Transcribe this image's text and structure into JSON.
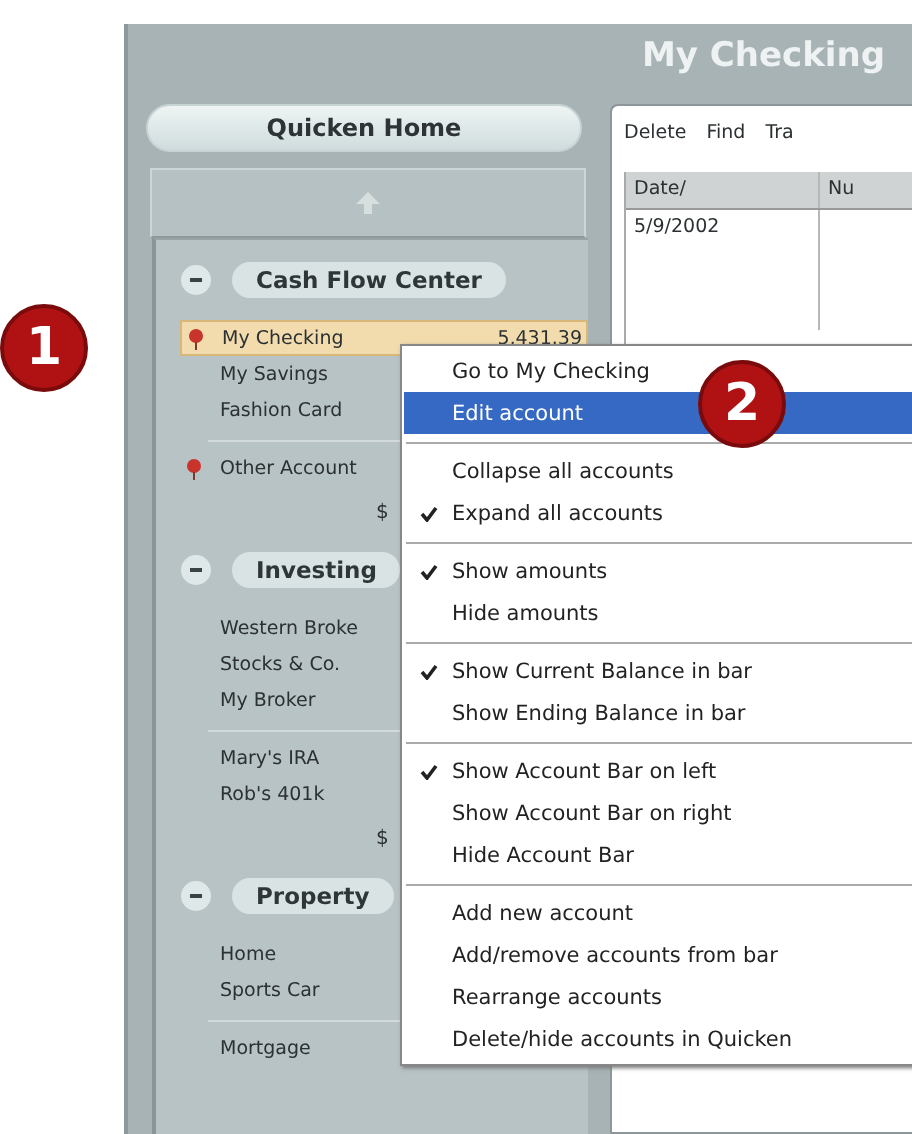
{
  "window": {
    "title": "My Checking"
  },
  "sidebar": {
    "home_button": "Quicken Home",
    "sections": [
      {
        "title": "Cash Flow Center",
        "expanded": true,
        "groups": [
          [
            {
              "name": "My Checking",
              "amount": "5,431.39",
              "flagged": true,
              "selected": true
            },
            {
              "name": "My Savings",
              "flagged": false,
              "selected": false
            },
            {
              "name": "Fashion Card",
              "flagged": false,
              "selected": false
            }
          ],
          [
            {
              "name": "Other Account",
              "flagged": true,
              "selected": false
            }
          ]
        ],
        "total": "$"
      },
      {
        "title": "Investing",
        "expanded": true,
        "groups": [
          [
            {
              "name": "Western Broke",
              "flagged": false,
              "selected": false
            },
            {
              "name": "Stocks & Co.",
              "flagged": false,
              "selected": false
            },
            {
              "name": "My Broker",
              "flagged": false,
              "selected": false
            }
          ],
          [
            {
              "name": "Mary's IRA",
              "flagged": false,
              "selected": false
            },
            {
              "name": "Rob's 401k",
              "flagged": false,
              "selected": false
            }
          ]
        ],
        "total": "$"
      },
      {
        "title": "Property",
        "expanded": true,
        "groups": [
          [
            {
              "name": "Home",
              "flagged": false,
              "selected": false
            },
            {
              "name": "Sports Car",
              "flagged": false,
              "selected": false
            }
          ],
          [
            {
              "name": "Mortgage",
              "flagged": false,
              "selected": false
            }
          ]
        ]
      }
    ]
  },
  "register": {
    "toolbar": [
      "Delete",
      "Find",
      "Tra"
    ],
    "columns": [
      "Date/",
      "Nu"
    ],
    "rows": [
      [
        "5/9/2002"
      ]
    ]
  },
  "context_menu": [
    [
      {
        "label": "Go to My Checking",
        "checked": false,
        "selected": false
      },
      {
        "label": "Edit account",
        "checked": false,
        "selected": true
      }
    ],
    [
      {
        "label": "Collapse all accounts",
        "checked": false,
        "selected": false
      },
      {
        "label": "Expand all accounts",
        "checked": true,
        "selected": false
      }
    ],
    [
      {
        "label": "Show amounts",
        "checked": true,
        "selected": false
      },
      {
        "label": "Hide amounts",
        "checked": false,
        "selected": false
      }
    ],
    [
      {
        "label": "Show Current Balance in bar",
        "checked": true,
        "selected": false
      },
      {
        "label": "Show Ending Balance in bar",
        "checked": false,
        "selected": false
      }
    ],
    [
      {
        "label": "Show Account Bar on left",
        "checked": true,
        "selected": false
      },
      {
        "label": "Show Account Bar on right",
        "checked": false,
        "selected": false
      },
      {
        "label": "Hide Account Bar",
        "checked": false,
        "selected": false
      }
    ],
    [
      {
        "label": "Add new account",
        "checked": false,
        "selected": false
      },
      {
        "label": "Add/remove accounts from bar",
        "checked": false,
        "selected": false
      },
      {
        "label": "Rearrange accounts",
        "checked": false,
        "selected": false
      },
      {
        "label": "Delete/hide accounts in Quicken",
        "checked": false,
        "selected": false
      }
    ]
  ],
  "callouts": [
    {
      "number": "1"
    },
    {
      "number": "2"
    }
  ]
}
